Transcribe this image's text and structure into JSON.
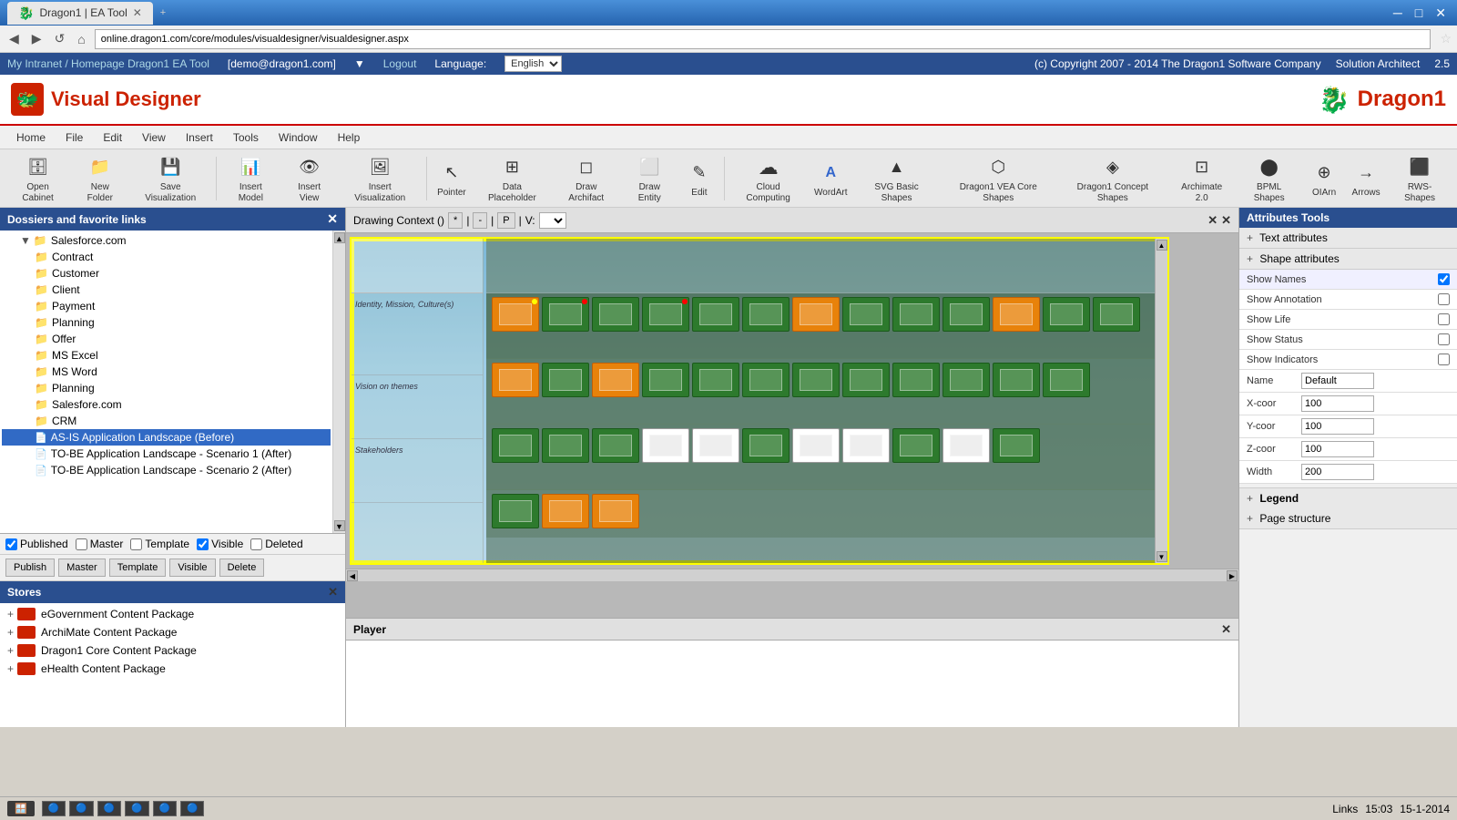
{
  "browser": {
    "tab_title": "Dragon1 | EA Tool",
    "address": "online.dragon1.com/core/modules/visualdesigner/visualdesigner.aspx",
    "back_btn": "◀",
    "forward_btn": "▶",
    "refresh_btn": "↺",
    "home_btn": "⌂"
  },
  "topbar": {
    "intranet_link": "My Intranet / Homepage Dragon1 EA Tool",
    "user": "[demo@dragon1.com]",
    "logout": "Logout",
    "language_label": "Language:",
    "language": "English",
    "copyright": "(c) Copyright 2007 - 2014 The Dragon1 Software Company",
    "role": "Solution Architect",
    "version": "2.5"
  },
  "app": {
    "title": "Visual Designer",
    "logo_icon": "🐉",
    "brand": "Dragon1"
  },
  "menubar": {
    "items": [
      "Home",
      "File",
      "Edit",
      "View",
      "Insert",
      "Tools",
      "Window",
      "Help"
    ]
  },
  "toolbar": {
    "items": [
      {
        "label": "Open Cabinet",
        "icon": "🗄"
      },
      {
        "label": "New Folder",
        "icon": "📁"
      },
      {
        "label": "Save Visualization",
        "icon": "💾"
      },
      {
        "label": "Insert Model",
        "icon": "📊"
      },
      {
        "label": "Insert View",
        "icon": "👁"
      },
      {
        "label": "Insert Visualization",
        "icon": "🖼"
      },
      {
        "label": "Pointer",
        "icon": "↖"
      },
      {
        "label": "Data Placeholder",
        "icon": "⊞"
      },
      {
        "label": "Draw Archifact",
        "icon": "◻"
      },
      {
        "label": "Draw Entity",
        "icon": "⬜"
      },
      {
        "label": "Edit",
        "icon": "✎"
      },
      {
        "label": "Cloud Computing",
        "icon": "☁"
      },
      {
        "label": "WordArt",
        "icon": "A"
      },
      {
        "label": "SVG Basic Shapes",
        "icon": "▲"
      },
      {
        "label": "Dragon1 VEA Core Shapes",
        "icon": "⬡"
      },
      {
        "label": "Dragon1 Concept Shapes",
        "icon": "◈"
      },
      {
        "label": "Archimate 2.0",
        "icon": "⊡"
      },
      {
        "label": "BPML Shapes",
        "icon": "⬤"
      },
      {
        "label": "OIArn",
        "icon": "⊕"
      },
      {
        "label": "Arrows",
        "icon": "→"
      },
      {
        "label": "RWS-Shapes",
        "icon": "⬛"
      }
    ]
  },
  "dossiers": {
    "title": "Dossiers and favorite links",
    "items": [
      {
        "name": "Salesforce.com",
        "type": "folder",
        "level": 1
      },
      {
        "name": "Contract",
        "type": "folder",
        "level": 2
      },
      {
        "name": "Customer",
        "type": "folder",
        "level": 2
      },
      {
        "name": "Client",
        "type": "folder",
        "level": 2
      },
      {
        "name": "Payment",
        "type": "folder",
        "level": 2
      },
      {
        "name": "Planning",
        "type": "folder",
        "level": 2
      },
      {
        "name": "Offer",
        "type": "folder",
        "level": 2
      },
      {
        "name": "MS Excel",
        "type": "folder",
        "level": 2
      },
      {
        "name": "MS Word",
        "type": "folder",
        "level": 2
      },
      {
        "name": "Planning",
        "type": "folder",
        "level": 2
      },
      {
        "name": "Salesfore.com",
        "type": "folder",
        "level": 2
      },
      {
        "name": "CRM",
        "type": "folder",
        "level": 2
      },
      {
        "name": "AS-IS Application Landscape (Before)",
        "type": "doc",
        "level": 2,
        "selected": true
      },
      {
        "name": "TO-BE Application Landscape - Scenario 1 (After)",
        "type": "doc",
        "level": 2
      },
      {
        "name": "TO-BE Application Landscape - Scenario 2 (After)",
        "type": "doc",
        "level": 2
      }
    ]
  },
  "checkboxes": {
    "published_label": "Published",
    "master_label": "Master",
    "template_label": "Template",
    "visible_label": "Visible",
    "deleted_label": "Deleted",
    "published_checked": true,
    "visible_checked": true
  },
  "action_buttons": {
    "publish": "Publish",
    "master": "Master",
    "template": "Template",
    "visible": "Visible",
    "delete": "Delete"
  },
  "stores": {
    "title": "Stores",
    "items": [
      {
        "name": "eGovernment Content Package",
        "expanded": false
      },
      {
        "name": "ArchiMate Content Package",
        "expanded": false
      },
      {
        "name": "Dragon1 Core Content Package",
        "expanded": false
      },
      {
        "name": "eHealth Content Package",
        "expanded": false
      }
    ]
  },
  "drawing": {
    "context_label": "Drawing Context ()",
    "symbols": [
      "*",
      "|",
      "-",
      "|",
      "P",
      "|",
      "V:"
    ],
    "sections": [
      {
        "label": "Identity, Mission, Culture(s)"
      },
      {
        "label": "Vision on themes"
      },
      {
        "label": "Stakeholders"
      }
    ]
  },
  "attributes": {
    "title": "Attributes Tools",
    "text_attr": "Text attributes",
    "shape_attr": "Shape attributes",
    "show_names": "Show Names",
    "show_names_checked": true,
    "show_annotation": "Show Annotation",
    "show_annotation_checked": false,
    "show_life": "Show Life",
    "show_life_checked": false,
    "show_status": "Show Status",
    "show_status_checked": false,
    "show_indicators": "Show Indicators",
    "show_indicators_checked": false,
    "name_label": "Name",
    "name_value": "Default",
    "xcoor_label": "X-coor",
    "xcoor_value": "100",
    "ycoor_label": "Y-coor",
    "ycoor_value": "100",
    "zcoor_label": "Z-coor",
    "zcoor_value": "100",
    "width_label": "Width",
    "width_value": "200"
  },
  "legend": {
    "title": "Legend",
    "page_structure": "Page structure"
  },
  "player": {
    "title": "Player"
  },
  "statusbar": {
    "links": "Links",
    "time": "15:03",
    "date": "15-1-2014"
  }
}
